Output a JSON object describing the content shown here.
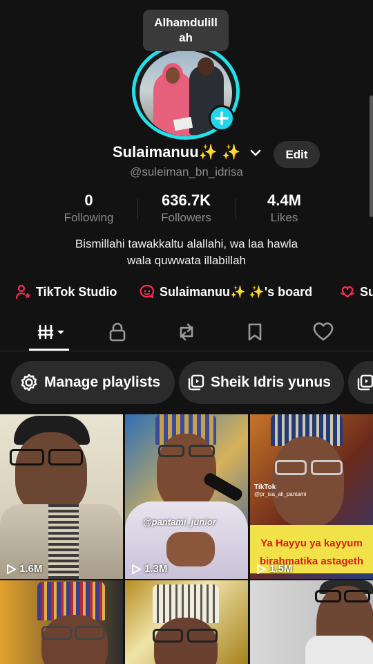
{
  "tooltip": "Alhamdulillah",
  "tooltip_line1": "Alhamdulill",
  "tooltip_line2": "ah",
  "profile": {
    "name": "Sulaimanuu✨ ✨",
    "handle": "@suleiman_bn_idrisa",
    "edit_label": "Edit",
    "bio_line1": "Bismillahi tawakkaltu alallahi, wa laa hawla",
    "bio_line2": "wala quwwata illabillah"
  },
  "stats": [
    {
      "value": "0",
      "label": "Following"
    },
    {
      "value": "636.7K",
      "label": "Followers"
    },
    {
      "value": "4.4M",
      "label": "Likes"
    }
  ],
  "links": [
    {
      "label": "TikTok Studio",
      "icon": "studio-person-icon"
    },
    {
      "label": "Sulaimanuu✨ ✨'s board",
      "icon": "board-chat-icon"
    },
    {
      "label": "Su",
      "icon": "heart-hands-icon"
    }
  ],
  "tabs": [
    {
      "name": "videos-grid",
      "icon": "grid-icon",
      "active": true
    },
    {
      "name": "private",
      "icon": "lock-icon"
    },
    {
      "name": "reposts",
      "icon": "repost-icon"
    },
    {
      "name": "favorites",
      "icon": "bookmark-icon"
    },
    {
      "name": "liked",
      "icon": "heart-icon"
    }
  ],
  "chips": [
    {
      "label": "Manage playlists",
      "icon": "gear-icon"
    },
    {
      "label": "Sheik Idris yunus",
      "icon": "playlist-icon"
    }
  ],
  "videos": [
    {
      "views": "1.6M"
    },
    {
      "views": "1.3M",
      "caption": "@pantami_junior"
    },
    {
      "views": "1.5M",
      "overlay_line1": "Ya Hayyu ya kayyum",
      "overlay_line2": "birahmatika astageth",
      "tag": "TikTok",
      "tag_handle": "@pr_isa_ali_pantami"
    },
    {},
    {},
    {}
  ],
  "colors": {
    "background": "#121212",
    "accent_cyan": "#20d5ec",
    "accent_red": "#fe2c55",
    "chip_bg": "#2b2b2b"
  }
}
